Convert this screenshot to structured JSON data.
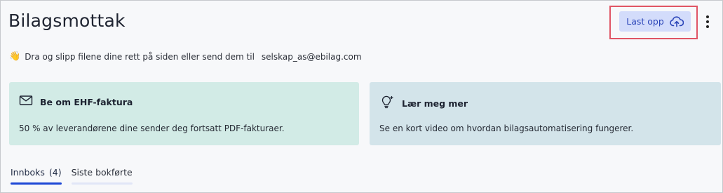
{
  "header": {
    "title": "Bilagsmottak",
    "upload_label": "Last opp",
    "upload_icon": "cloud-upload-icon",
    "more_icon": "more-vertical-icon"
  },
  "hint": {
    "emoji": "👋",
    "text": "Dra og slipp filene dine rett på siden eller send dem til",
    "email": "selskap_as@ebilag.com"
  },
  "cards": [
    {
      "icon": "mail-icon",
      "title": "Be om EHF-faktura",
      "text": "50 % av leverandørene dine sender deg fortsatt PDF-fakturaer."
    },
    {
      "icon": "lightbulb-icon",
      "title": "Lær meg mer",
      "text": "Se en kort video om hvordan bilagsautomatisering fungerer."
    }
  ],
  "tabs": [
    {
      "label": "Innboks",
      "count": "(4)",
      "active": true
    },
    {
      "label": "Siste bokførte",
      "count": "",
      "active": false
    }
  ],
  "colors": {
    "accent": "#1d47d6",
    "upload_bg": "#d3dcfb",
    "card_ehf_bg": "#d2ebe6",
    "card_learn_bg": "#d3e4ea",
    "highlight": "#e05565"
  }
}
